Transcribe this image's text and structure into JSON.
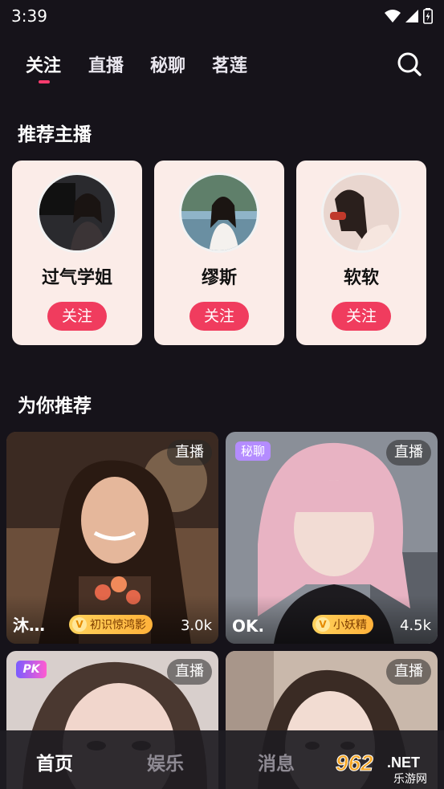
{
  "status_bar": {
    "time": "3:39"
  },
  "top_tabs": [
    {
      "label": "关注"
    },
    {
      "label": "直播"
    },
    {
      "label": "秘聊"
    },
    {
      "label": "茗莲"
    }
  ],
  "recommended_streamers": {
    "title": "推荐主播",
    "items": [
      {
        "name": "过气学姐",
        "follow_label": "关注"
      },
      {
        "name": "缪斯",
        "follow_label": "关注"
      },
      {
        "name": "软软",
        "follow_label": "关注"
      }
    ]
  },
  "for_you": {
    "title": "为你推荐",
    "cards": [
      {
        "tag": "直播",
        "name": "沐…",
        "badge": "初识惊鸿影",
        "count": "3.0k"
      },
      {
        "tag": "直播",
        "corner_tag": "秘聊",
        "name": "OK.",
        "badge": "小妖精",
        "count": "4.5k"
      },
      {
        "tag": "直播",
        "corner_tag": "PK"
      },
      {
        "tag": "直播"
      }
    ]
  },
  "bottom_nav": [
    {
      "label": "首页"
    },
    {
      "label": "娱乐"
    },
    {
      "label": "消息"
    }
  ],
  "watermark": {
    "brand": "962.NET",
    "subtitle": "乐游网"
  },
  "colors": {
    "accent": "#f03c5e",
    "card_bg": "#fbece8",
    "page_bg": "#16131a"
  }
}
